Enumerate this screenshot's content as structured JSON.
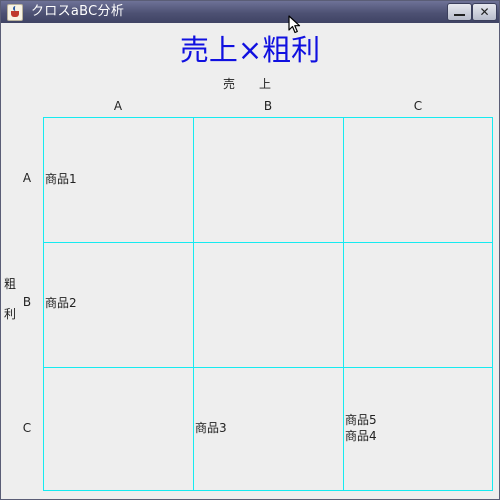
{
  "window": {
    "title": "クロスaBC分析",
    "icon": "java-cup-icon",
    "minimize_glyph": "minimize-icon",
    "close_glyph": "✕"
  },
  "matrix": {
    "title": "売上×粗利",
    "x_axis_label": "売　上",
    "y_axis_label": "粗利",
    "y_axis_label_chars": [
      "粗",
      "利"
    ],
    "columns": [
      "A",
      "B",
      "C"
    ],
    "rows": [
      "A",
      "B",
      "C"
    ],
    "cells": {
      "AA": [],
      "AB": [],
      "AC": [],
      "BA": [],
      "BB": [],
      "BC": [],
      "CA": [],
      "CB": [],
      "CC": []
    },
    "items": {
      "r1c1": [
        "商品1"
      ],
      "r2c1": [
        "商品2"
      ],
      "r3c2": [
        "商品3"
      ],
      "r3c3": [
        "商品5",
        "商品4"
      ]
    },
    "grid_color": "#15eaf0",
    "title_color": "#1010e0"
  }
}
